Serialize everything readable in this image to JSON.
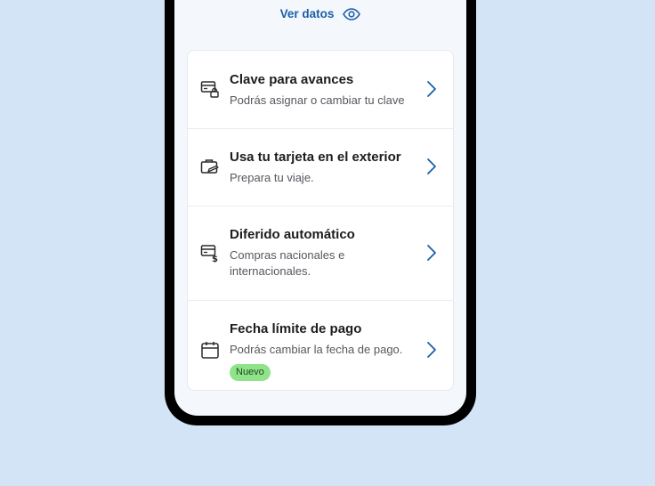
{
  "header": {
    "ver_datos_label": "Ver datos"
  },
  "menu": {
    "items": [
      {
        "title": "Clave para avances",
        "subtitle": "Podrás asignar o cambiar tu clave"
      },
      {
        "title": "Usa tu tarjeta en el exterior",
        "subtitle": "Prepara tu viaje."
      },
      {
        "title": "Diferido automático",
        "subtitle": "Compras nacionales e internacionales."
      },
      {
        "title": "Fecha límite de pago",
        "subtitle": "Podrás cambiar la fecha de pago.",
        "badge": "Nuevo"
      }
    ]
  },
  "colors": {
    "accent": "#1a5fa8",
    "badge_bg": "#8fe38a",
    "background": "#d4e4f7"
  },
  "icons": [
    "eye-icon",
    "card-lock-icon",
    "suitcase-plane-icon",
    "card-dollar-icon",
    "calendar-icon",
    "chevron-right-icon"
  ]
}
